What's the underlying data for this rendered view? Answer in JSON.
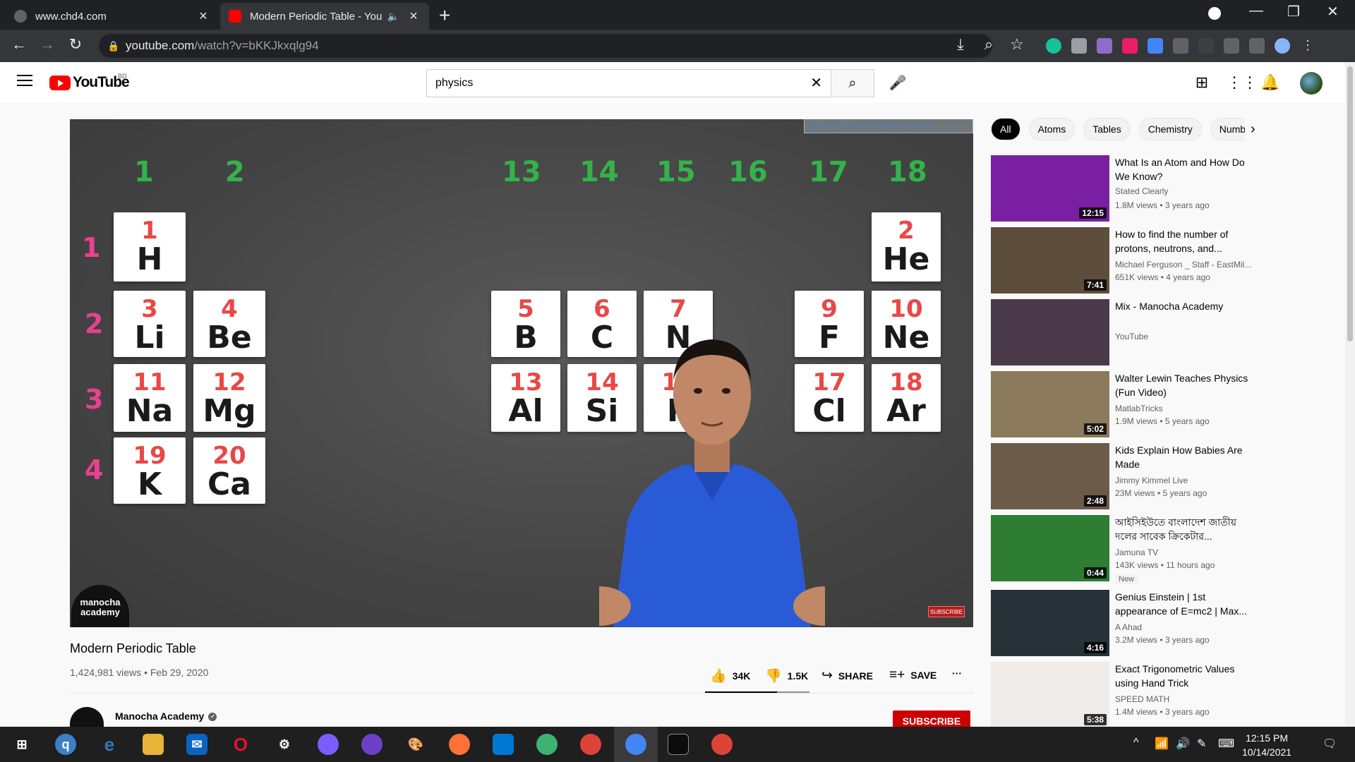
{
  "browser": {
    "tabs": [
      {
        "title": "www.chd4.com",
        "close": "×"
      },
      {
        "title": "Modern Periodic Table - You",
        "close": "×"
      }
    ],
    "new_tab": "+",
    "url_host": "youtube.com",
    "url_path": "/watch?v=bKKJkxqlg94"
  },
  "youtube": {
    "logo_text": "YouTube",
    "country": "BD",
    "search_value": "physics"
  },
  "video": {
    "overlay_download": "▶ Download this video",
    "group_labels": [
      "1",
      "2",
      "13",
      "14",
      "15",
      "16",
      "17",
      "18"
    ],
    "period_labels": [
      "1",
      "2",
      "3",
      "4"
    ],
    "elements": [
      {
        "n": "1",
        "s": "H"
      },
      {
        "n": "2",
        "s": "He"
      },
      {
        "n": "3",
        "s": "Li"
      },
      {
        "n": "4",
        "s": "Be"
      },
      {
        "n": "5",
        "s": "B"
      },
      {
        "n": "6",
        "s": "C"
      },
      {
        "n": "7",
        "s": "N"
      },
      {
        "n": "9",
        "s": "F"
      },
      {
        "n": "10",
        "s": "Ne"
      },
      {
        "n": "11",
        "s": "Na"
      },
      {
        "n": "12",
        "s": "Mg"
      },
      {
        "n": "13",
        "s": "Al"
      },
      {
        "n": "14",
        "s": "Si"
      },
      {
        "n": "15",
        "s": "P"
      },
      {
        "n": "17",
        "s": "Cl"
      },
      {
        "n": "18",
        "s": "Ar"
      },
      {
        "n": "19",
        "s": "K"
      },
      {
        "n": "20",
        "s": "Ca"
      }
    ],
    "channel_watermark": "manocha academy",
    "subscribe_small": "SUBSCRIBE",
    "title": "Modern Periodic Table",
    "views": "1,424,981 views",
    "date": "Feb 29, 2020",
    "likes": "34K",
    "dislikes": "1.5K",
    "share": "SHARE",
    "save": "SAVE",
    "more": "···",
    "like_fraction": 0.69,
    "channel_name": "Manocha Academy",
    "subscribe": "SUBSCRIBE"
  },
  "chips": [
    "All",
    "Atoms",
    "Tables",
    "Chemistry",
    "Numb"
  ],
  "recommendations": [
    {
      "title": "What Is an Atom and How Do We Know?",
      "channel": "Stated Clearly",
      "stats": "1.8M views • 3 years ago",
      "duration": "12:15",
      "thumb_color": "#7b1fa2"
    },
    {
      "title": "How to find the number of protons, neutrons, and...",
      "channel": "Michael Ferguson _ Staff - EastMil...",
      "stats": "651K views • 4 years ago",
      "duration": "7:41",
      "thumb_color": "#5d4e3c"
    },
    {
      "title": "Mix - Manocha Academy",
      "channel": "YouTube",
      "stats": "",
      "duration": "",
      "thumb_color": "#4a3a4a"
    },
    {
      "title": "Walter Lewin Teaches Physics (Fun Video)",
      "channel": "MatlabTricks",
      "stats": "1.9M views • 5 years ago",
      "duration": "5:02",
      "thumb_color": "#8c7a5c"
    },
    {
      "title": "Kids Explain How Babies Are Made",
      "channel": "Jimmy Kimmel Live",
      "stats": "23M views • 5 years ago",
      "duration": "2:48",
      "thumb_color": "#6d5b4a"
    },
    {
      "title": "আইসিইউতে বাংলাদেশ জাতীয় দলের সাবেক ক্রিকেটার...",
      "channel": "Jamuna TV",
      "stats": "143K views • 11 hours ago",
      "duration": "0:44",
      "thumb_color": "#2e7d32",
      "badge": "New"
    },
    {
      "title": "Genius Einstein | 1st appearance of E=mc2 | Max...",
      "channel": "A Ahad",
      "stats": "3.2M views • 3 years ago",
      "duration": "4:16",
      "thumb_color": "#263238"
    },
    {
      "title": "Exact Trigonometric Values using Hand Trick",
      "channel": "SPEED MATH",
      "stats": "1.4M views • 3 years ago",
      "duration": "5:38",
      "thumb_color": "#efebe9"
    }
  ],
  "taskbar": {
    "time": "12:15 PM",
    "date": "10/14/2021"
  }
}
